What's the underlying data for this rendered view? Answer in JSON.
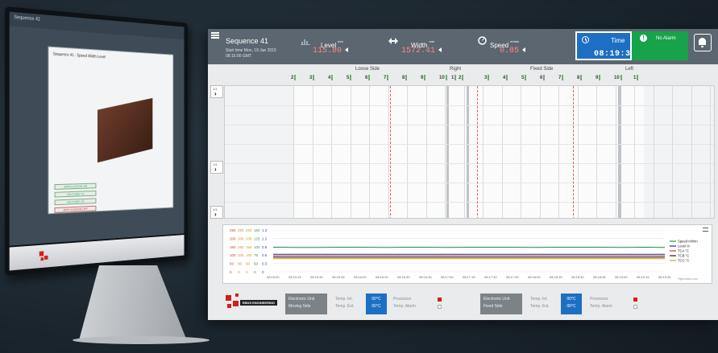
{
  "mockup": {
    "menu_title": "Sequence 41",
    "window_caption": "Sequence 41 - Speed Width Level",
    "button_1": "APPLICATION ON",
    "button_2": "LECTURE TC",
    "button_3": "LECTURE HT",
    "button_4": "APPLICATION OFF"
  },
  "header": {
    "title": "Sequence 41",
    "start_time": "Start time Mon, 19 Jan 2015 08:15:00 GMT",
    "level": {
      "label": "Level",
      "unit": "mm",
      "value": "115.80"
    },
    "width": {
      "label": "Width",
      "unit": "mm",
      "value": "1572.41"
    },
    "speed": {
      "label": "Speed",
      "unit": "m/min",
      "value": "0.85"
    },
    "time": {
      "label": "Time",
      "value": "08:19:36"
    },
    "alarm": {
      "label": "No Alarm"
    }
  },
  "heatmap": {
    "sections": [
      "Loose Side",
      "Right",
      "Fixed Side",
      "Left"
    ],
    "loose_ticks": [
      "2",
      "3",
      "4",
      "5",
      "6",
      "7",
      "8",
      "9",
      "10"
    ],
    "right_ticks": [
      "1",
      "2"
    ],
    "fixed_ticks": [
      "3",
      "4",
      "5",
      "6",
      "7",
      "8",
      "9",
      "10"
    ],
    "left_ticks": [
      "1"
    ],
    "side_button_top": "1/1",
    "side_button_mid": "1/1",
    "side_button_bot": "1/1"
  },
  "chart_data": {
    "type": "line",
    "x": [
      "08:15:00",
      "08:15:15",
      "08:15:30",
      "08:15:45",
      "08:16:00",
      "08:16:15",
      "08:16:30",
      "08:16:45",
      "08:17:00",
      "08:17:15",
      "08:17:30",
      "08:17:45",
      "08:18:00",
      "08:18:15",
      "08:18:30",
      "08:18:45",
      "08:19:00",
      "08:19:15",
      "08:19:30"
    ],
    "y_axes": [
      {
        "ticks": [
          "250",
          "200",
          "150",
          "100",
          "50",
          "0"
        ],
        "color": "#d04040"
      },
      {
        "ticks": [
          "250",
          "200",
          "150",
          "100",
          "50",
          "0"
        ],
        "color": "#e28a2a"
      },
      {
        "ticks": [
          "250",
          "200",
          "150",
          "100",
          "50",
          "0"
        ],
        "color": "#c8a020"
      },
      {
        "ticks": [
          "150",
          "125",
          "100",
          "75",
          "50",
          "0"
        ],
        "color": "#3a9a3a"
      },
      {
        "ticks": [
          "1.2",
          "1.2",
          "0.9",
          "0.6",
          "0.3",
          "0"
        ],
        "color": "#2b4fb5"
      }
    ],
    "series": [
      {
        "name": "Speed m/min",
        "color": "#1f9a4a",
        "values": [
          0.88,
          0.87,
          0.87,
          0.88,
          0.88,
          0.87,
          0.88,
          0.88,
          0.87,
          0.88,
          0.88,
          0.88,
          0.87,
          0.88,
          0.88,
          0.88,
          0.87,
          0.88,
          0.87
        ],
        "axis": 4
      },
      {
        "name": "Level %",
        "color": "#1c2d8a",
        "values": [
          0.63,
          0.63,
          0.63,
          0.63,
          0.63,
          0.63,
          0.63,
          0.63,
          0.63,
          0.63,
          0.63,
          0.63,
          0.63,
          0.63,
          0.63,
          0.63,
          0.63,
          0.63,
          0.63
        ],
        "axis": 4
      },
      {
        "name": "TCA °C",
        "color": "#d13a3a",
        "values": [
          0.57,
          0.57,
          0.57,
          0.57,
          0.57,
          0.57,
          0.57,
          0.57,
          0.57,
          0.57,
          0.57,
          0.57,
          0.57,
          0.57,
          0.57,
          0.57,
          0.57,
          0.57,
          0.57
        ],
        "axis": 4
      },
      {
        "name": "TCB °C",
        "color": "#222222",
        "values": [
          0.52,
          0.52,
          0.52,
          0.52,
          0.52,
          0.52,
          0.52,
          0.52,
          0.52,
          0.52,
          0.52,
          0.52,
          0.52,
          0.52,
          0.52,
          0.52,
          0.52,
          0.52,
          0.52
        ],
        "axis": 4
      },
      {
        "name": "TCC °C",
        "color": "#d9a020",
        "values": [
          0.47,
          0.47,
          0.47,
          0.47,
          0.47,
          0.47,
          0.47,
          0.47,
          0.47,
          0.47,
          0.47,
          0.47,
          0.47,
          0.47,
          0.47,
          0.47,
          0.47,
          0.47,
          0.47
        ],
        "axis": 4
      }
    ],
    "credit": "Highcharts.com"
  },
  "status": {
    "logo_text": "EBDS ENGINEERING",
    "moving": {
      "unit_label": "Electronic Unit",
      "unit_side": "Moving Side",
      "temp_int": "Temp. Int.",
      "temp_ext": "Temp. Ext.",
      "temp_int_val": "00°C",
      "temp_ext_val": "00°C",
      "processor": "Processor",
      "temp_alarm": "Temp. Alarm"
    },
    "fixed": {
      "unit_label": "Electronic Unit",
      "unit_side": "Fixed Side",
      "temp_int": "Temp. Int.",
      "temp_ext": "Temp. Ext.",
      "temp_int_val": "00°C",
      "temp_ext_val": "00°C",
      "processor": "Processor",
      "temp_alarm": "Temp. Alarm"
    }
  }
}
